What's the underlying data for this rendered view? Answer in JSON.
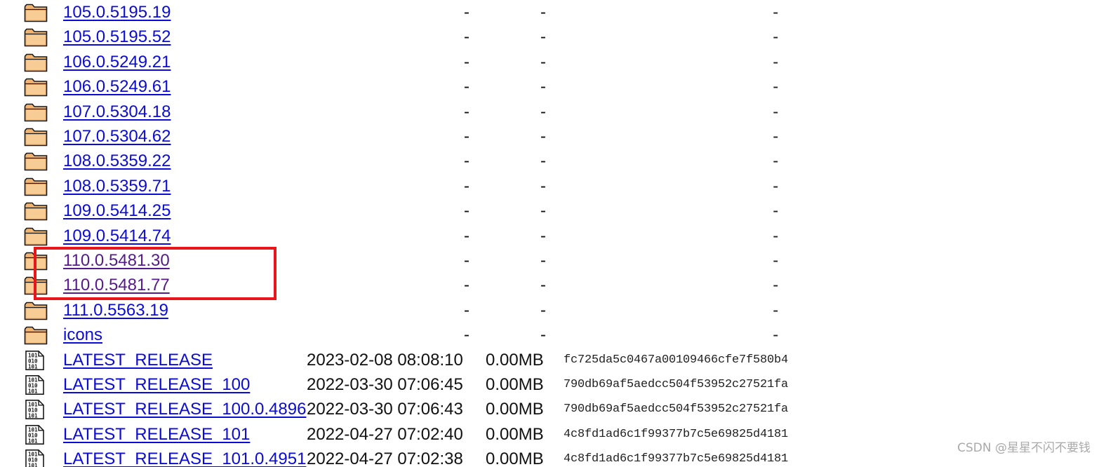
{
  "dash": "-",
  "rows": [
    {
      "type": "folder",
      "name": "105.0.5195.19",
      "visited": false
    },
    {
      "type": "folder",
      "name": "105.0.5195.52",
      "visited": false
    },
    {
      "type": "folder",
      "name": "106.0.5249.21",
      "visited": false
    },
    {
      "type": "folder",
      "name": "106.0.5249.61",
      "visited": false
    },
    {
      "type": "folder",
      "name": "107.0.5304.18",
      "visited": false
    },
    {
      "type": "folder",
      "name": "107.0.5304.62",
      "visited": false
    },
    {
      "type": "folder",
      "name": "108.0.5359.22",
      "visited": false
    },
    {
      "type": "folder",
      "name": "108.0.5359.71",
      "visited": false
    },
    {
      "type": "folder",
      "name": "109.0.5414.25",
      "visited": false
    },
    {
      "type": "folder",
      "name": "109.0.5414.74",
      "visited": false
    },
    {
      "type": "folder",
      "name": "110.0.5481.30",
      "visited": true
    },
    {
      "type": "folder",
      "name": "110.0.5481.77",
      "visited": true
    },
    {
      "type": "folder",
      "name": "111.0.5563.19",
      "visited": false
    },
    {
      "type": "folder",
      "name": "icons",
      "visited": false
    },
    {
      "type": "file",
      "name": "LATEST_RELEASE",
      "visited": false,
      "date": "2023-02-08 08:08:10",
      "size": "0.00MB",
      "hash": "fc725da5c0467a00109466cfe7f580b4"
    },
    {
      "type": "file",
      "name": "LATEST_RELEASE_100",
      "visited": false,
      "date": "2022-03-30 07:06:45",
      "size": "0.00MB",
      "hash": "790db69af5aedcc504f53952c27521fa"
    },
    {
      "type": "file",
      "name": "LATEST_RELEASE_100.0.4896",
      "visited": false,
      "date": "2022-03-30 07:06:43",
      "size": "0.00MB",
      "hash": "790db69af5aedcc504f53952c27521fa"
    },
    {
      "type": "file",
      "name": "LATEST_RELEASE_101",
      "visited": false,
      "date": "2022-04-27 07:02:40",
      "size": "0.00MB",
      "hash": "4c8fd1ad6c1f99377b7c5e69825d4181"
    },
    {
      "type": "file",
      "name": "LATEST_RELEASE_101.0.4951",
      "visited": false,
      "date": "2022-04-27 07:02:38",
      "size": "0.00MB",
      "hash": "4c8fd1ad6c1f99377b7c5e69825d4181"
    }
  ],
  "highlight_color": "#e8161b",
  "link_color": "#0b0bd6",
  "visited_link_color": "#551a8b",
  "watermark": "CSDN @星星不闪不要钱"
}
